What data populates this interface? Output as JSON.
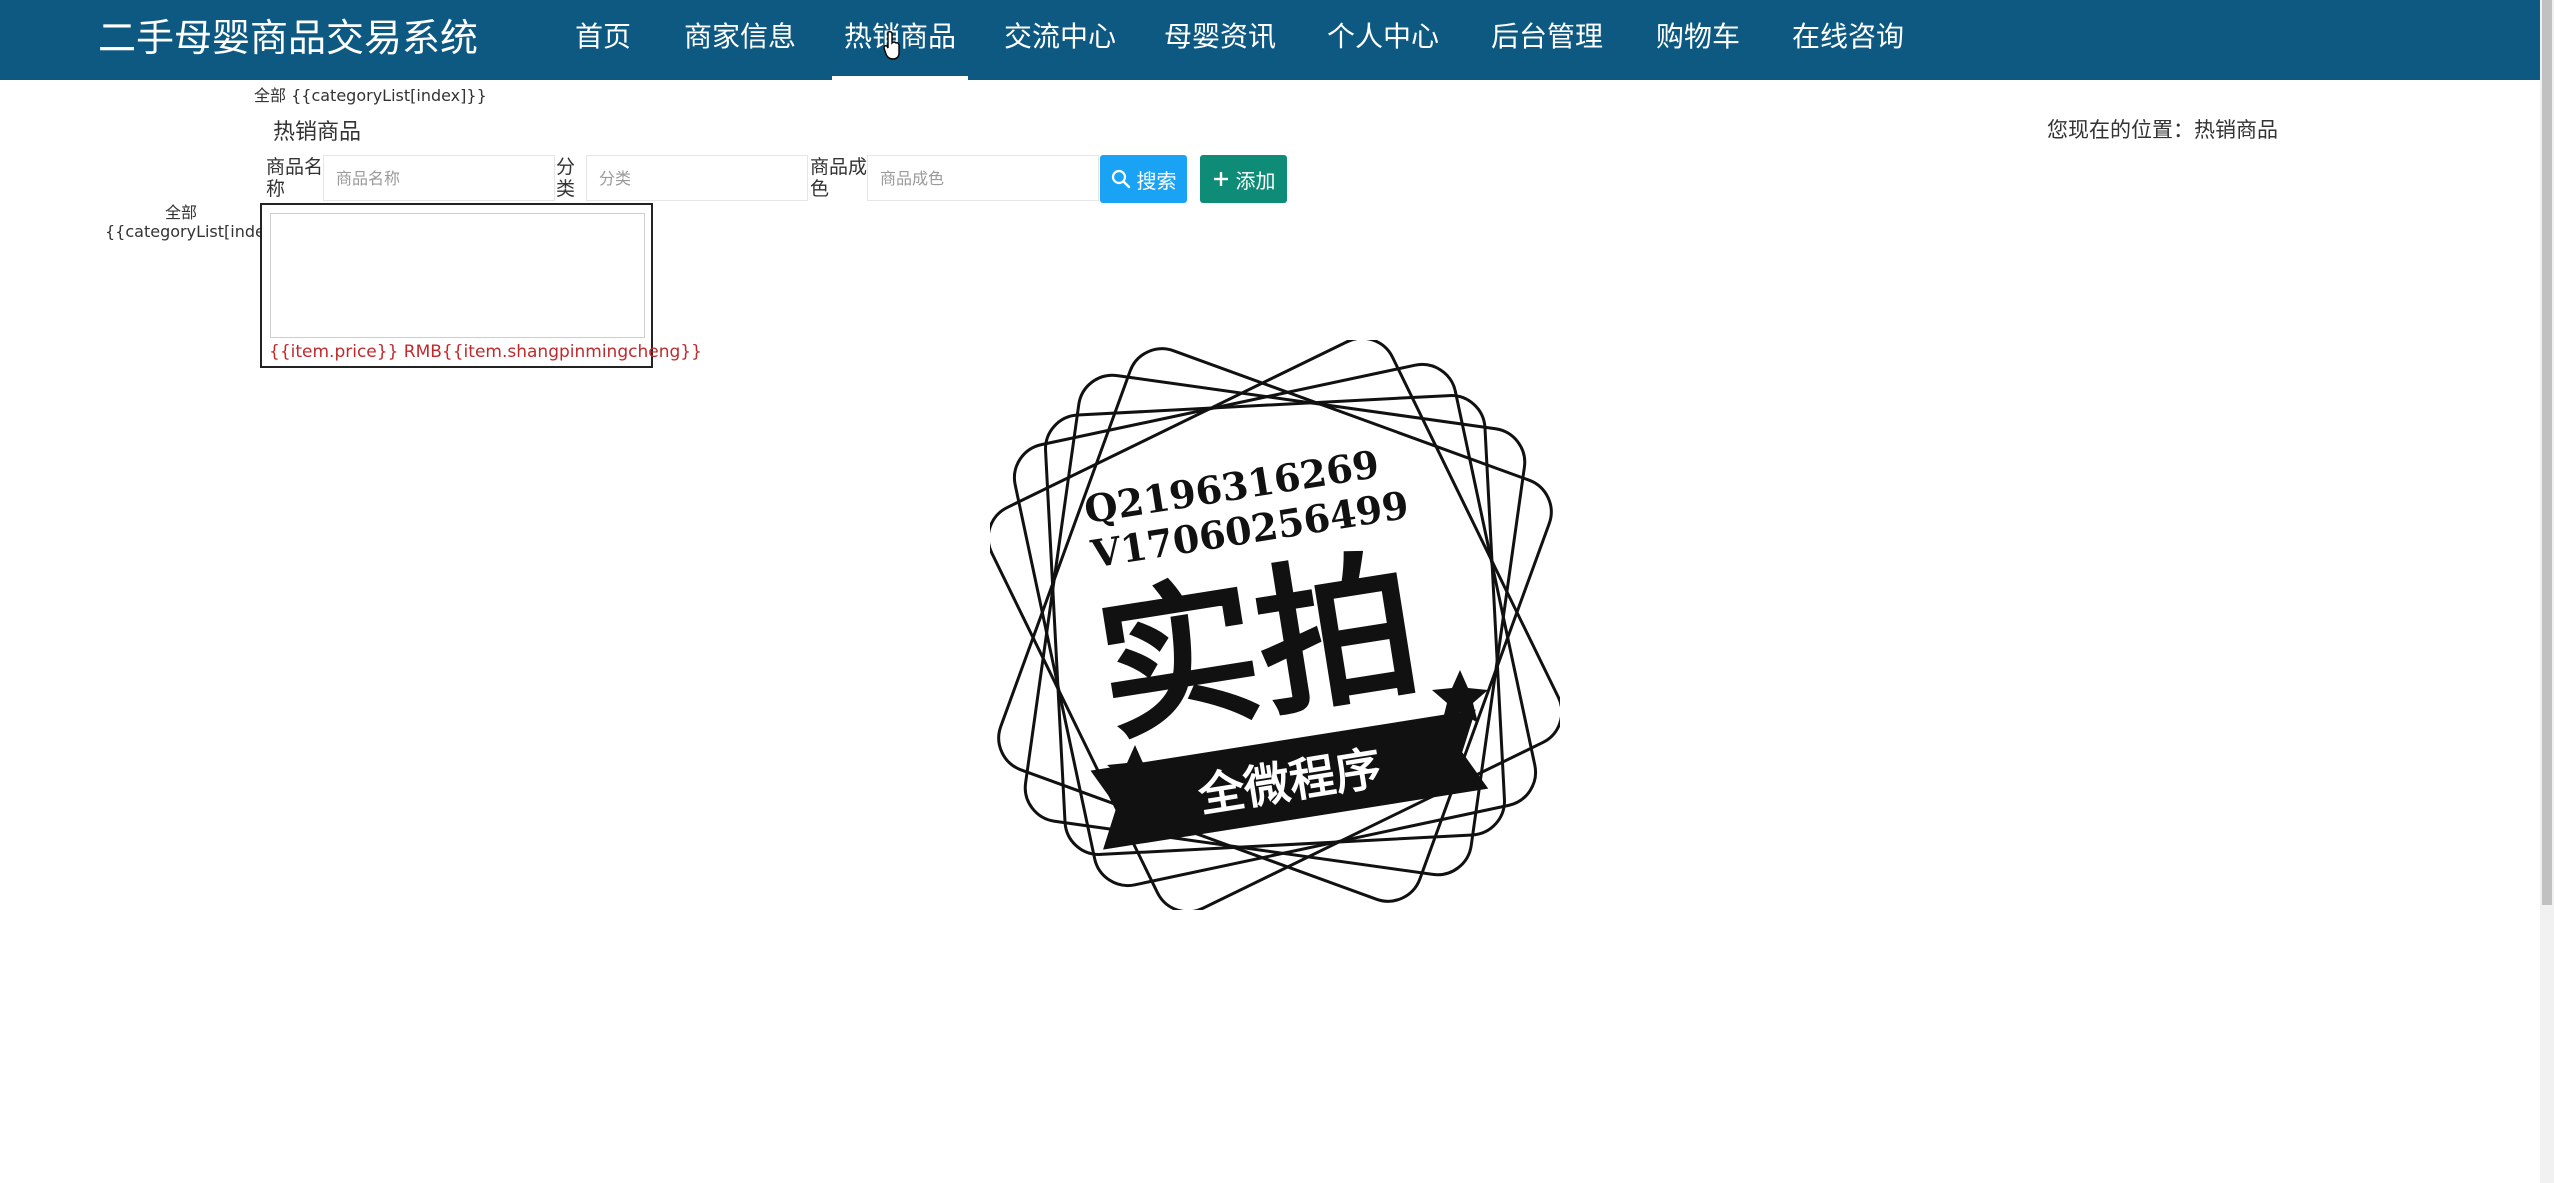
{
  "header": {
    "brand": "二手母婴商品交易系统",
    "nav": [
      {
        "label": "首页"
      },
      {
        "label": "商家信息"
      },
      {
        "label": "热销商品"
      },
      {
        "label": "交流中心"
      },
      {
        "label": "母婴资讯"
      },
      {
        "label": "个人中心"
      },
      {
        "label": "后台管理"
      },
      {
        "label": "购物车"
      },
      {
        "label": "在线咨询"
      }
    ],
    "active_nav": "热销商品",
    "nav_color": "#0d5982"
  },
  "category_top": "全部 {{categoryList[index]}}",
  "page": {
    "title": "热销商品",
    "breadcrumb": "您现在的位置：热销商品"
  },
  "filters": {
    "name_label": "商品名称",
    "name_placeholder": "商品名称",
    "category_label": "分类",
    "category_placeholder": "分类",
    "condition_label": "商品成色",
    "condition_placeholder": "商品成色",
    "search_button": "搜索",
    "add_button": "添加",
    "search_color": "#1aa3f5",
    "add_color": "#0e8c77"
  },
  "category_side": {
    "all": "全部",
    "template": "{{categoryList[index]}}"
  },
  "product": {
    "caption": "{{item.price}} RMB{{item.shangpinmingcheng}}"
  },
  "watermark": {
    "line1": "Q2196316269",
    "line2": "V17060256499",
    "big_text": "实拍",
    "ribbon_text": "全微程序"
  }
}
